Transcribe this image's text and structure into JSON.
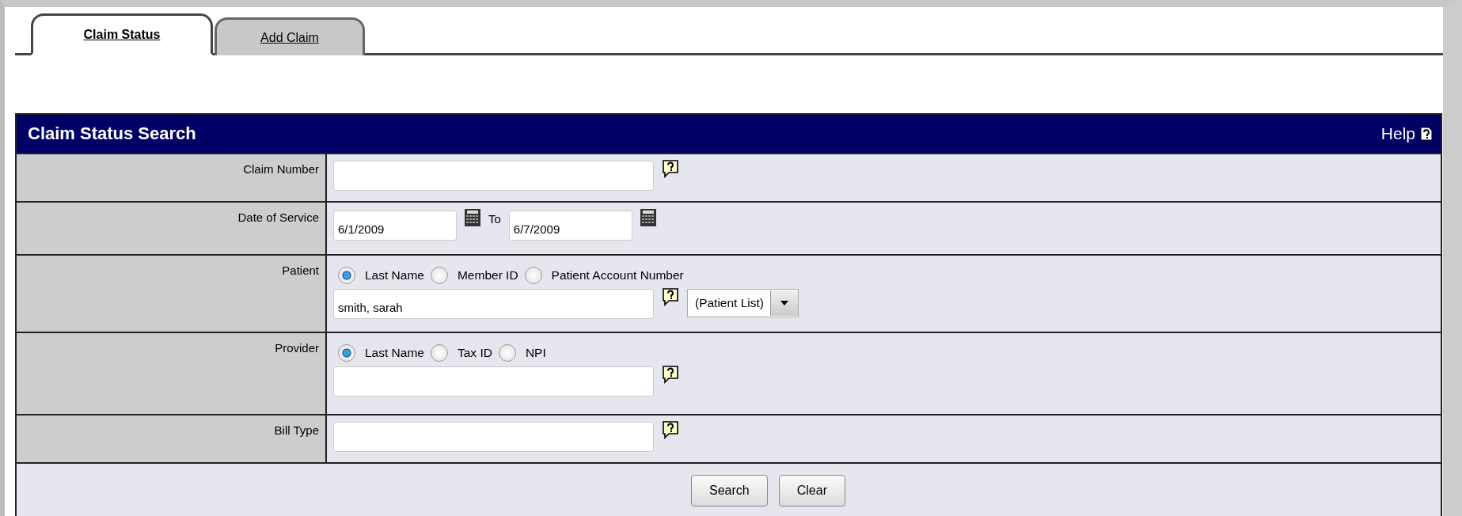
{
  "tabs": [
    {
      "label": "Claim Status",
      "selected": true
    },
    {
      "label": "Add Claim",
      "selected": false
    }
  ],
  "panel": {
    "title": "Claim Status Search",
    "help": "Help"
  },
  "rows": [
    {
      "label": "Claim Number",
      "kind": "text",
      "value": "",
      "help_icon": true
    },
    {
      "label": "Date of Service",
      "kind": "date_range",
      "from": "6/1/2009",
      "separator": "To",
      "to": "6/7/2009"
    },
    {
      "label": "Patient",
      "kind": "radio_text",
      "options": [
        {
          "label": "Last Name",
          "selected": true
        },
        {
          "label": "Member ID",
          "selected": false
        },
        {
          "label": "Patient Account Number",
          "selected": false
        }
      ],
      "value": "smith, sarah",
      "help_icon": true,
      "dropdown": "(Patient List)"
    },
    {
      "label": "Provider",
      "kind": "radio_text",
      "options": [
        {
          "label": "Last Name",
          "selected": true
        },
        {
          "label": "Tax ID",
          "selected": false
        },
        {
          "label": "NPI",
          "selected": false
        }
      ],
      "value": "",
      "help_icon": true
    },
    {
      "label": "Bill Type",
      "kind": "text",
      "value": "",
      "help_icon": true
    }
  ],
  "buttons": [
    "Search",
    "Clear"
  ]
}
